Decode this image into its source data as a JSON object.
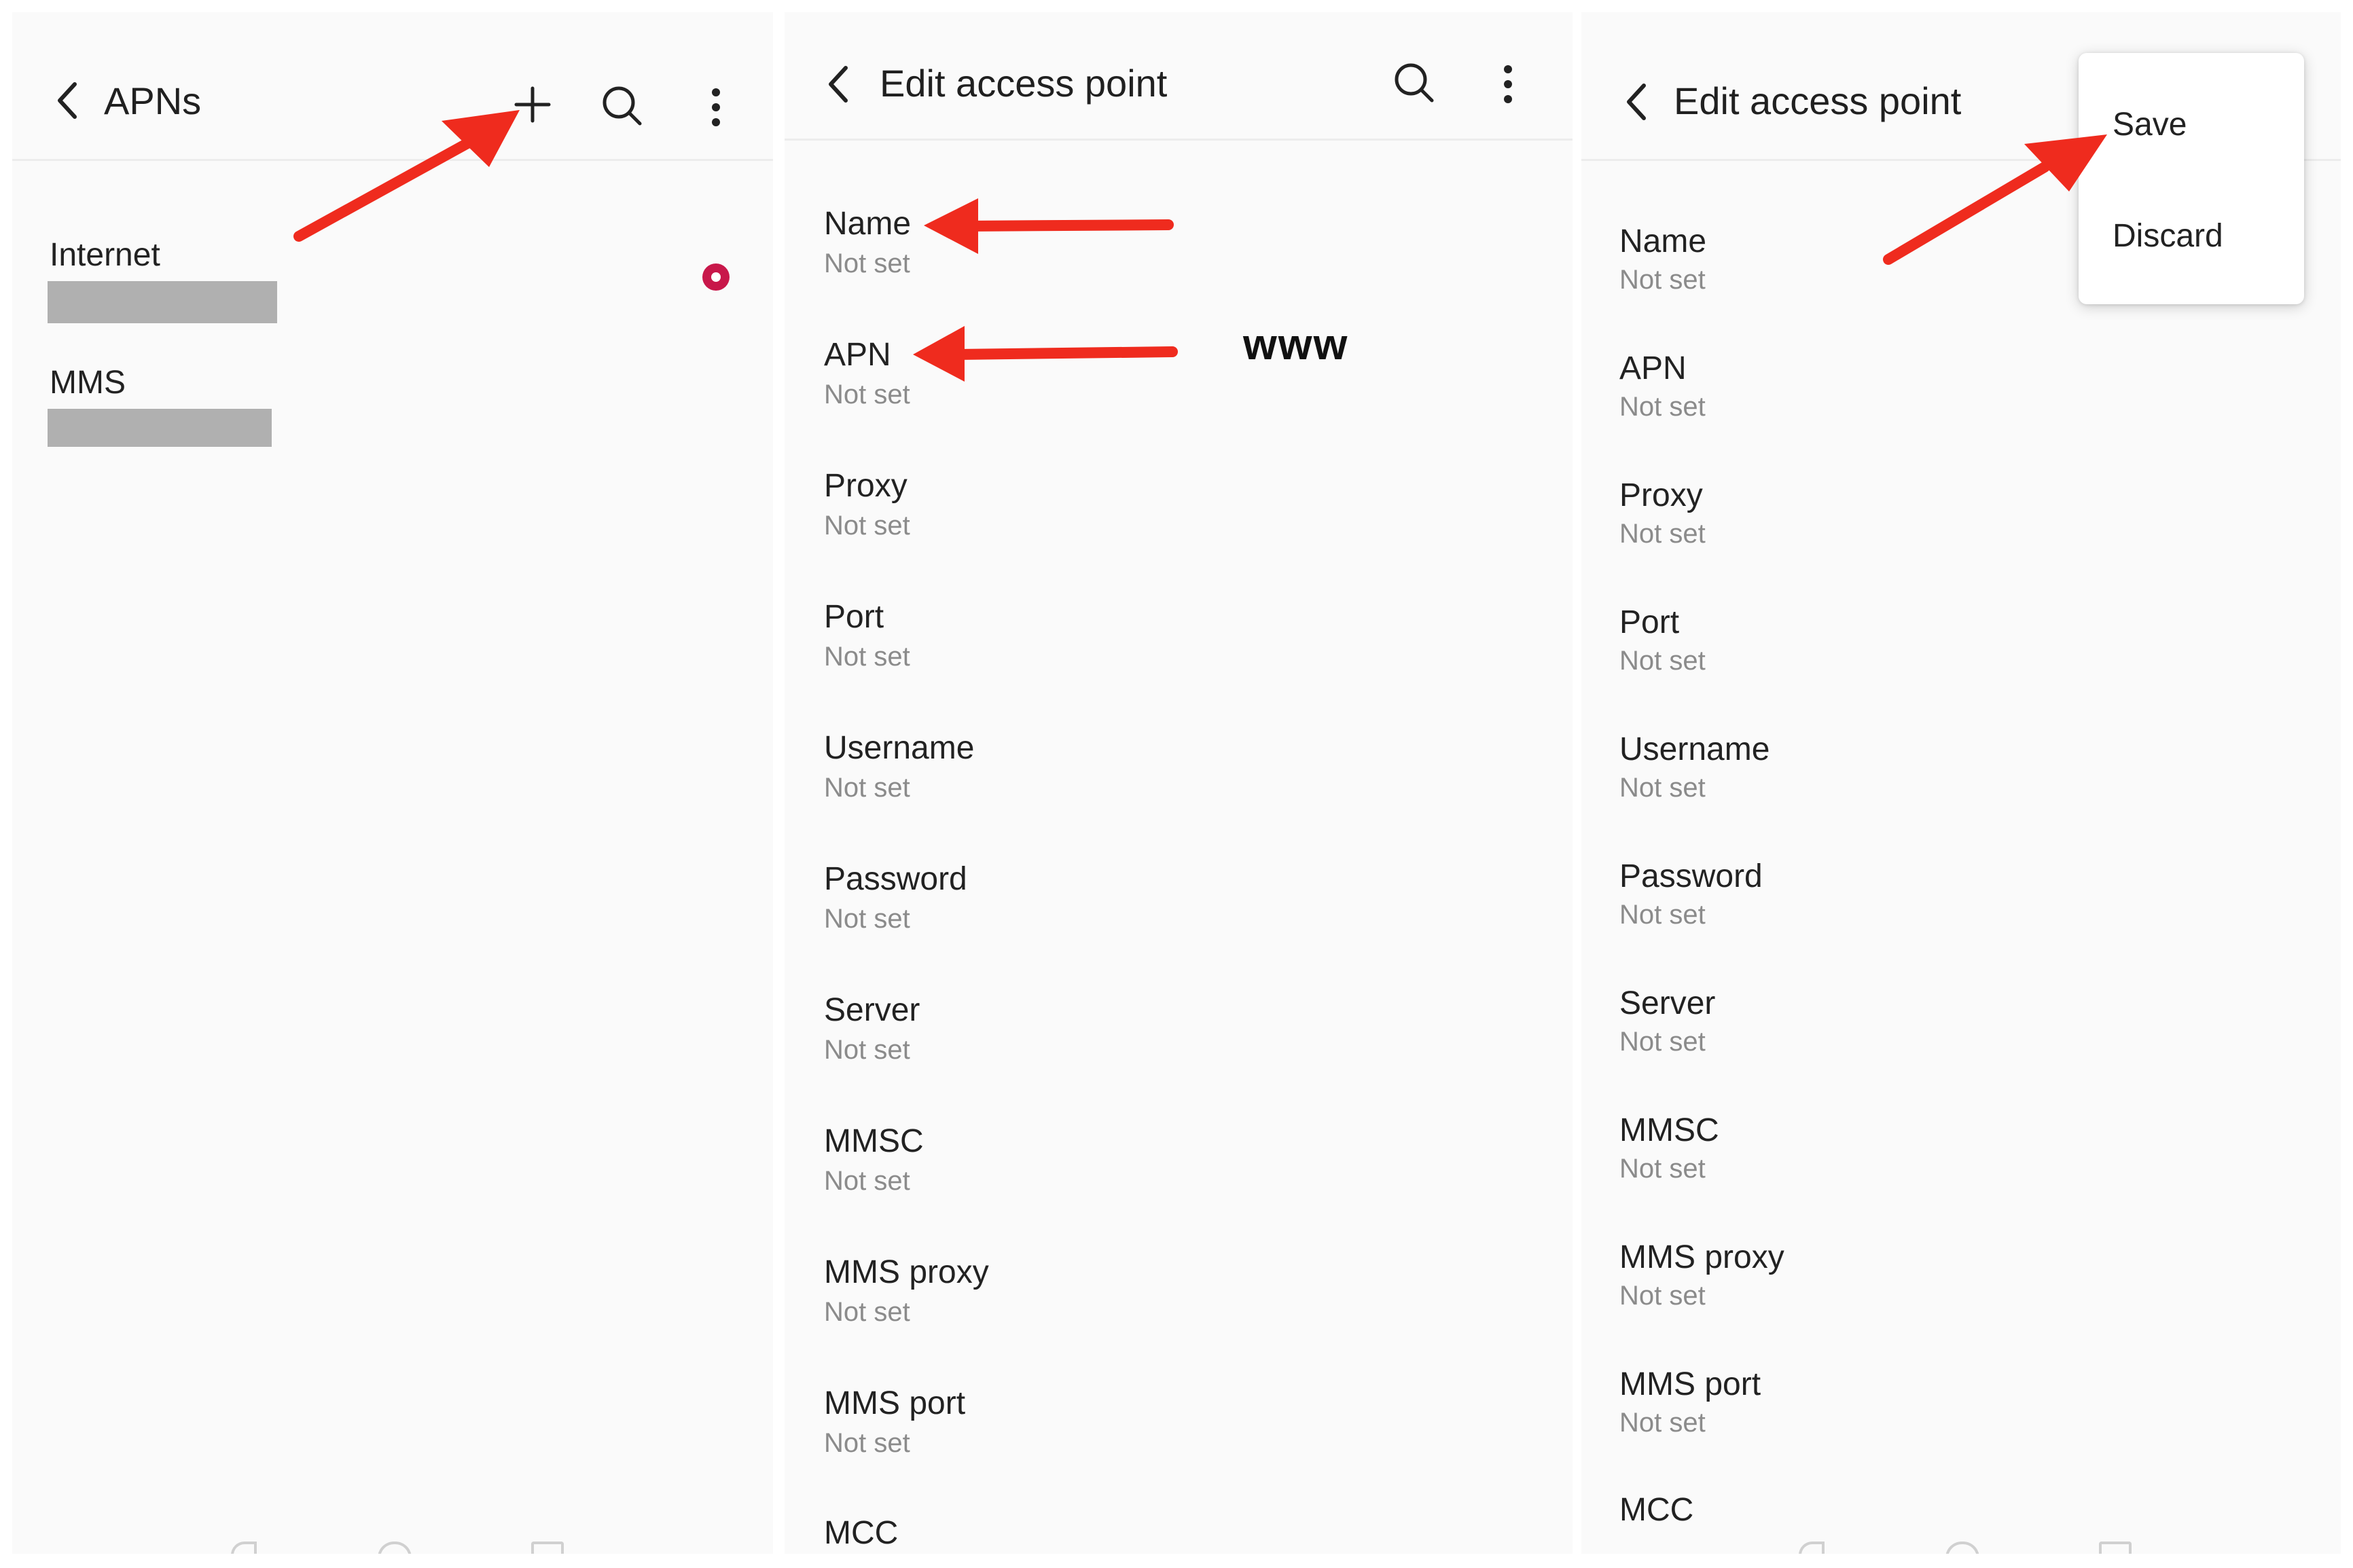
{
  "colors": {
    "accent": "#c8174a",
    "annotation_arrow": "#ef2b1e",
    "background": "#fafafa",
    "secondary_text": "#8b8b8b"
  },
  "screen1": {
    "title": "APNs",
    "back_icon": "chevron-left-icon",
    "add_icon": "plus-icon",
    "search_icon": "search-icon",
    "more_icon": "more-vertical-icon",
    "apns": [
      {
        "name": "Internet",
        "selected": true
      },
      {
        "name": "MMS",
        "selected": false
      }
    ]
  },
  "screen2": {
    "title": "Edit access point",
    "back_icon": "chevron-left-icon",
    "search_icon": "search-icon",
    "more_icon": "more-vertical-icon",
    "fields": [
      {
        "label": "Name",
        "value": "Not set"
      },
      {
        "label": "APN",
        "value": "Not set"
      },
      {
        "label": "Proxy",
        "value": "Not set"
      },
      {
        "label": "Port",
        "value": "Not set"
      },
      {
        "label": "Username",
        "value": "Not set"
      },
      {
        "label": "Password",
        "value": "Not set"
      },
      {
        "label": "Server",
        "value": "Not set"
      },
      {
        "label": "MMSC",
        "value": "Not set"
      },
      {
        "label": "MMS proxy",
        "value": "Not set"
      },
      {
        "label": "MMS port",
        "value": "Not set"
      },
      {
        "label": "MCC",
        "value": ""
      }
    ]
  },
  "screen3": {
    "title": "Edit access point",
    "back_icon": "chevron-left-icon",
    "fields": [
      {
        "label": "Name",
        "value": "Not set"
      },
      {
        "label": "APN",
        "value": "Not set"
      },
      {
        "label": "Proxy",
        "value": "Not set"
      },
      {
        "label": "Port",
        "value": "Not set"
      },
      {
        "label": "Username",
        "value": "Not set"
      },
      {
        "label": "Password",
        "value": "Not set"
      },
      {
        "label": "Server",
        "value": "Not set"
      },
      {
        "label": "MMSC",
        "value": "Not set"
      },
      {
        "label": "MMS proxy",
        "value": "Not set"
      },
      {
        "label": "MMS port",
        "value": "Not set"
      },
      {
        "label": "MCC",
        "value": ""
      }
    ],
    "menu": {
      "save": "Save",
      "discard": "Discard"
    }
  },
  "annotation": {
    "apn_hint": "www"
  }
}
